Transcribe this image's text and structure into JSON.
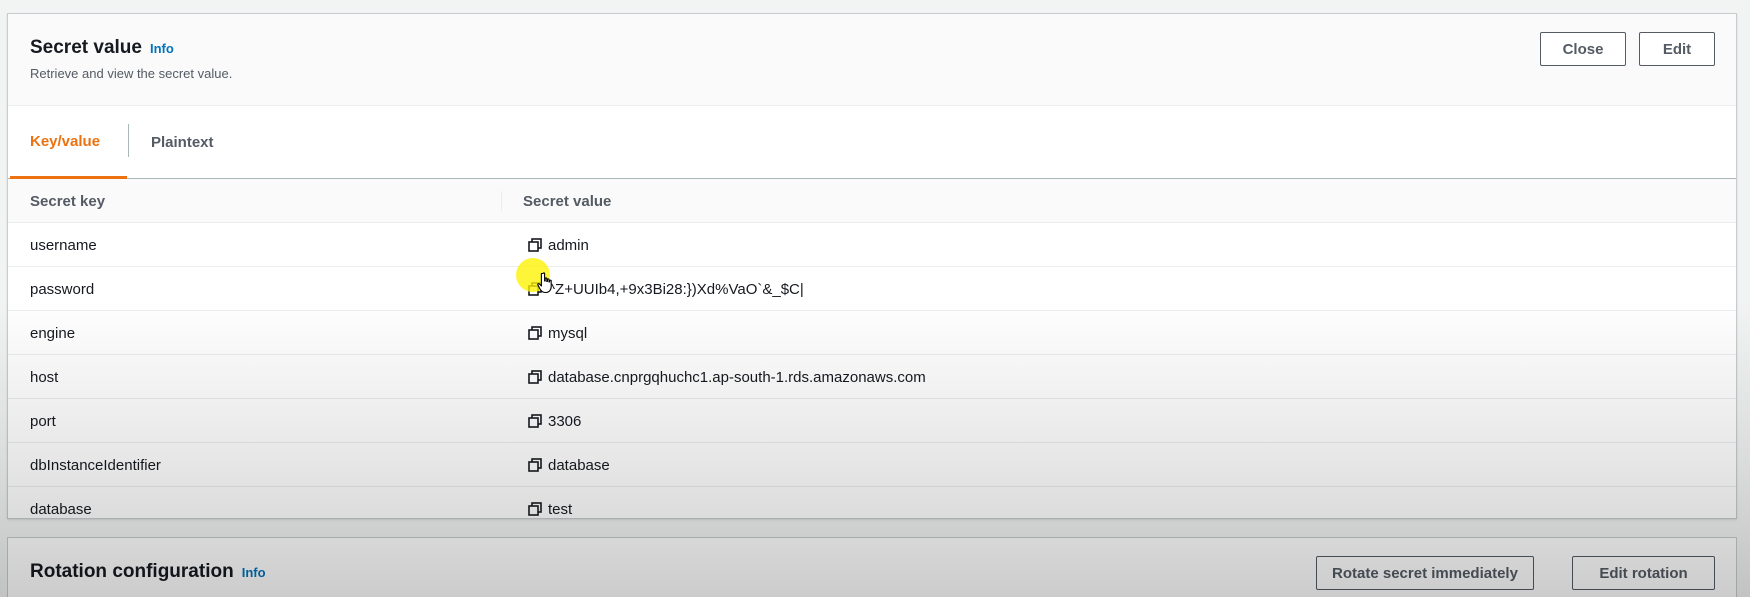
{
  "secret_panel": {
    "title": "Secret value",
    "info_label": "Info",
    "subtitle": "Retrieve and view the secret value.",
    "close_label": "Close",
    "edit_label": "Edit"
  },
  "tabs": [
    {
      "label": "Key/value",
      "active": true
    },
    {
      "label": "Plaintext",
      "active": false
    }
  ],
  "table": {
    "col_key": "Secret key",
    "col_value": "Secret value",
    "rows": [
      {
        "key": "username",
        "value": "admin"
      },
      {
        "key": "password",
        "value": "^Z+UUIb4,+9x3Bi28:})Xd%VaO`&_$C|"
      },
      {
        "key": "engine",
        "value": "mysql"
      },
      {
        "key": "host",
        "value": "database.cnprgqhuchc1.ap-south-1.rds.amazonaws.com"
      },
      {
        "key": "port",
        "value": "3306"
      },
      {
        "key": "dbInstanceIdentifier",
        "value": "database"
      },
      {
        "key": "database",
        "value": "test"
      }
    ]
  },
  "rotation_panel": {
    "title": "Rotation configuration",
    "info_label": "Info",
    "rotate_label": "Rotate secret immediately",
    "edit_rotation_label": "Edit rotation"
  },
  "icons": {
    "copy": "copy-icon",
    "cursor": "hand-pointer-cursor"
  },
  "colors": {
    "accent_tab": "#ec7211",
    "info_link": "#0073bb",
    "highlight": "#fff200"
  }
}
